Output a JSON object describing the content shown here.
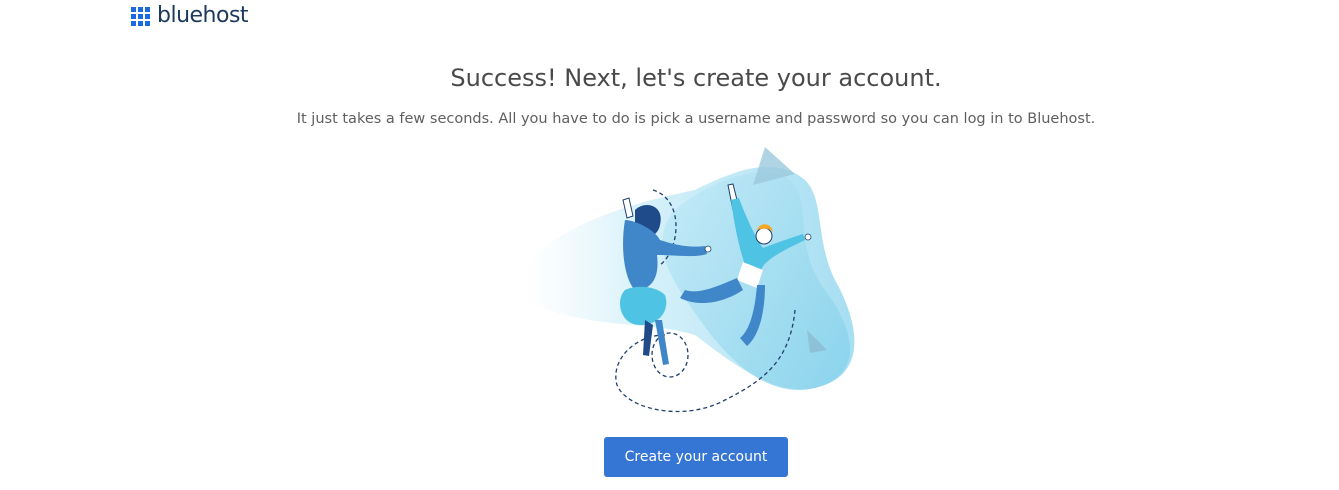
{
  "header": {
    "logo_text": "bluehost",
    "logo_icon": "grid-logo-icon"
  },
  "main": {
    "headline": "Success! Next, let's create your account.",
    "subtext": "It just takes a few seconds. All you have to do is pick a username and password so you can log in to Bluehost.",
    "illustration": "celebrating-people-illustration",
    "cta_label": "Create your account"
  },
  "colors": {
    "brand_blue": "#196bde",
    "button_blue": "#3575d3",
    "heading_text": "#4a4a4a",
    "body_text": "#5f5f5f"
  }
}
